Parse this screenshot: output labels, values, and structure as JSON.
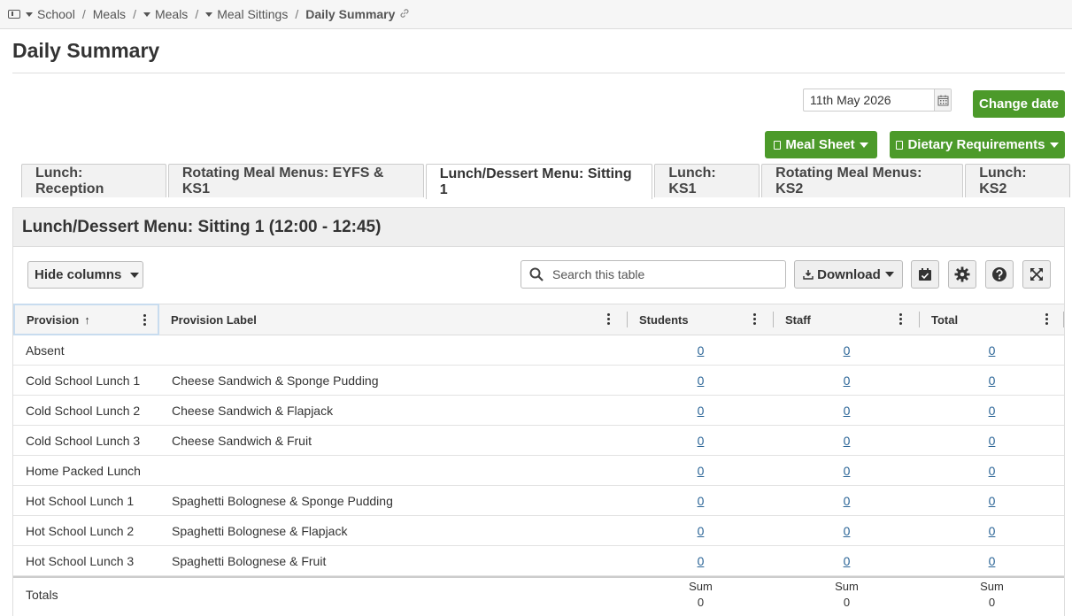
{
  "breadcrumb": {
    "items": [
      "School",
      "Meals",
      "Meals",
      "Meal Sittings"
    ],
    "current": "Daily Summary"
  },
  "page": {
    "title": "Daily Summary"
  },
  "date_picker": {
    "value": "11th May 2026"
  },
  "buttons": {
    "change_date": "Change date",
    "meal_sheet": "Meal Sheet",
    "dietary_requirements": "Dietary Requirements"
  },
  "tabs": [
    {
      "label": "Lunch: Reception"
    },
    {
      "label": "Rotating Meal Menus: EYFS & KS1"
    },
    {
      "label": "Lunch/Dessert Menu: Sitting 1",
      "active": true
    },
    {
      "label": "Lunch: KS1"
    },
    {
      "label": "Rotating Meal Menus: KS2"
    },
    {
      "label": "Lunch: KS2"
    }
  ],
  "panel": {
    "title": "Lunch/Dessert Menu: Sitting 1 (12:00 - 12:45)"
  },
  "toolbar": {
    "hide_columns": "Hide columns",
    "search_placeholder": "Search this table",
    "download": "Download"
  },
  "table": {
    "columns": [
      "Provision",
      "Provision Label",
      "Students",
      "Staff",
      "Total"
    ],
    "rows": [
      {
        "provision": "Absent",
        "label": "",
        "students": "0",
        "staff": "0",
        "total": "0"
      },
      {
        "provision": "Cold School Lunch 1",
        "label": "Cheese Sandwich & Sponge Pudding",
        "students": "0",
        "staff": "0",
        "total": "0"
      },
      {
        "provision": "Cold School Lunch 2",
        "label": "Cheese Sandwich & Flapjack",
        "students": "0",
        "staff": "0",
        "total": "0"
      },
      {
        "provision": "Cold School Lunch 3",
        "label": "Cheese Sandwich & Fruit",
        "students": "0",
        "staff": "0",
        "total": "0"
      },
      {
        "provision": "Home Packed Lunch",
        "label": "",
        "students": "0",
        "staff": "0",
        "total": "0"
      },
      {
        "provision": "Hot School Lunch 1",
        "label": "Spaghetti Bolognese & Sponge Pudding",
        "students": "0",
        "staff": "0",
        "total": "0"
      },
      {
        "provision": "Hot School Lunch 2",
        "label": "Spaghetti Bolognese & Flapjack",
        "students": "0",
        "staff": "0",
        "total": "0"
      },
      {
        "provision": "Hot School Lunch 3",
        "label": "Spaghetti Bolognese & Fruit",
        "students": "0",
        "staff": "0",
        "total": "0"
      }
    ],
    "totals": {
      "label": "Totals",
      "sum_label": "Sum",
      "students": "0",
      "staff": "0",
      "total": "0"
    }
  },
  "colors": {
    "accent_green": "#4c9a2a",
    "link": "#2a6496"
  }
}
